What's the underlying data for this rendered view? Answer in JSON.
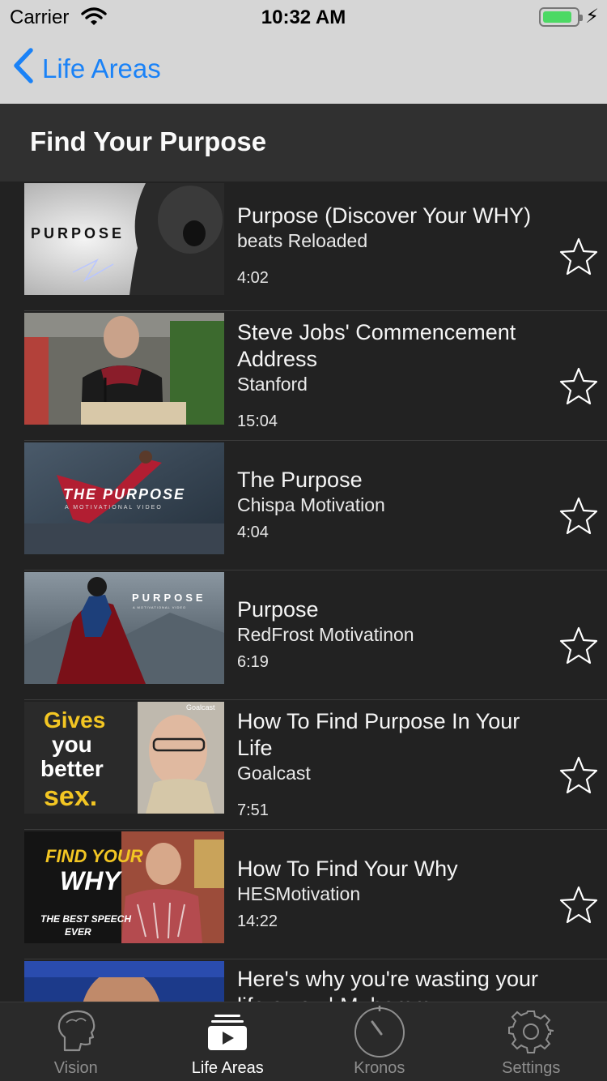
{
  "status_bar": {
    "carrier": "Carrier",
    "time": "10:32 AM",
    "wifi_icon": "wifi-icon",
    "battery_icon": "battery-icon",
    "charging_icon": "bolt-icon",
    "battery_color": "#4cd964"
  },
  "nav": {
    "back_label": "Life Areas",
    "back_icon": "chevron-left-icon",
    "accent": "#1a82f7"
  },
  "section": {
    "title": "Find Your Purpose"
  },
  "videos": [
    {
      "title": "Purpose (Discover Your WHY)",
      "channel": "beats Reloaded",
      "duration": "4:02",
      "thumb_text": "PURPOSE",
      "favorite": false
    },
    {
      "title": "Steve Jobs' Commencement Address",
      "channel": "Stanford",
      "duration": "15:04",
      "thumb_text": "",
      "favorite": false
    },
    {
      "title": "The Purpose",
      "channel": "Chispa Motivation",
      "duration": "4:04",
      "thumb_text": "THE PURPOSE",
      "thumb_subtext": "A MOTIVATIONAL VIDEO",
      "favorite": false
    },
    {
      "title": "Purpose",
      "channel": "RedFrost Motivatinon",
      "duration": "6:19",
      "thumb_text": "PURPOSE",
      "thumb_subtext": "A MOTIVATIONAL VIDEO",
      "favorite": false
    },
    {
      "title": "How To Find Purpose In Your Life",
      "channel": "Goalcast",
      "duration": "7:51",
      "thumb_text": "Gives you better sex.",
      "thumb_lines": [
        "Gives",
        "you",
        "better",
        "sex."
      ],
      "thumb_brand": "Goalcast",
      "favorite": false
    },
    {
      "title": "How To Find Your Why",
      "channel": "HESMotivation",
      "duration": "14:22",
      "thumb_lines": [
        "FIND YOUR",
        "WHY",
        "THE BEST SPEECH",
        "EVER"
      ],
      "favorite": false
    },
    {
      "title": "Here's why you're wasting your life away | Muhamm",
      "channel": "",
      "duration": "",
      "favorite": false
    }
  ],
  "tabs": [
    {
      "label": "Vision",
      "icon": "head-profile-icon",
      "active": false
    },
    {
      "label": "Life Areas",
      "icon": "video-library-icon",
      "active": true
    },
    {
      "label": "Kronos",
      "icon": "stopwatch-icon",
      "active": false
    },
    {
      "label": "Settings",
      "icon": "gear-icon",
      "active": false
    }
  ]
}
